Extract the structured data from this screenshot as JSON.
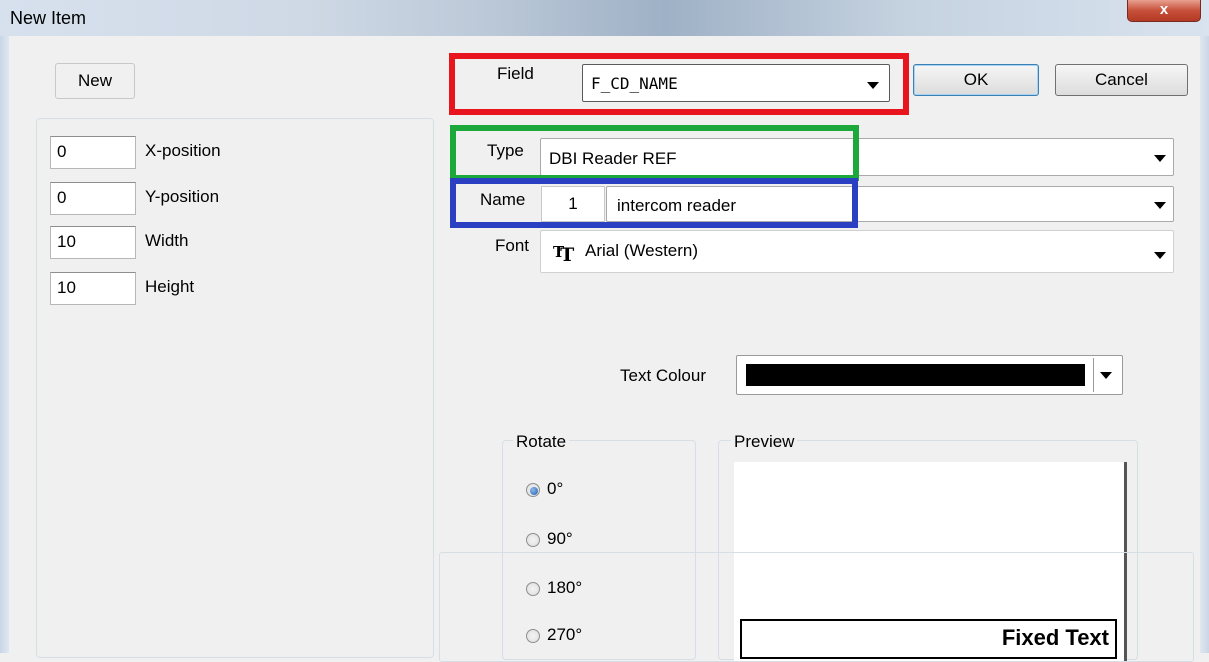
{
  "window": {
    "title": "New Item",
    "close_glyph": "x"
  },
  "toolbar": {
    "new_label": "New"
  },
  "field": {
    "label": "Field",
    "value": "F_CD_NAME"
  },
  "buttons": {
    "ok": "OK",
    "cancel": "Cancel"
  },
  "position": {
    "x": {
      "value": "0",
      "label": "X-position"
    },
    "y": {
      "value": "0",
      "label": "Y-position"
    },
    "width": {
      "value": "10",
      "label": "Width"
    },
    "height": {
      "value": "10",
      "label": "Height"
    }
  },
  "type": {
    "label": "Type",
    "value": "DBI Reader REF"
  },
  "name": {
    "label": "Name",
    "number": "1",
    "value": "intercom reader"
  },
  "font": {
    "label": "Font",
    "value": "Arial (Western)",
    "icon": "truetype-font-icon"
  },
  "text_colour": {
    "label": "Text Colour",
    "value": "#000000"
  },
  "rotate": {
    "label": "Rotate",
    "options": [
      "0°",
      "90°",
      "180°",
      "270°"
    ],
    "selected": "0°"
  },
  "preview": {
    "label": "Preview",
    "sample_text": "Fixed Text"
  },
  "colors": {
    "highlight_field": "#e8141e",
    "highlight_type": "#1ca83a",
    "highlight_name": "#2a3fc2"
  }
}
